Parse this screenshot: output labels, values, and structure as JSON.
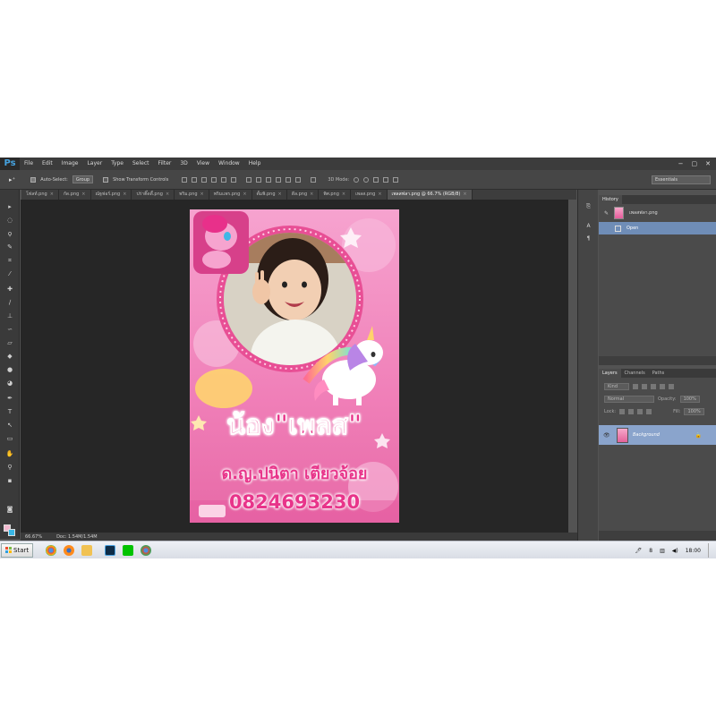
{
  "app": {
    "logo": "Ps"
  },
  "menu": [
    "File",
    "Edit",
    "Image",
    "Layer",
    "Type",
    "Select",
    "Filter",
    "3D",
    "View",
    "Window",
    "Help"
  ],
  "window_controls": [
    "−",
    "▢",
    "✕"
  ],
  "options": {
    "auto_select_label": "Auto-Select:",
    "group_value": "Group",
    "transform_label": "Show Transform Controls",
    "mode_3d": "3D Mode:",
    "workspace": "Essentials"
  },
  "tabs": [
    "โฟลท์.png",
    "กัด.png",
    "ณัฐฟอร์.png",
    "ปร่าติ๊ดดี้.png",
    "พริม.png",
    "พริมแพร.png",
    "ตั้มพิ.png",
    "ดีล.png",
    "พิศ.png",
    "เพลส.png",
    "เพลสฟลา.png @ 66.7% (RGB/8)"
  ],
  "poster": {
    "nickname": "น้อง\"เพลส\"",
    "fullname": "ด.ญ.ปนิตา เตียวจ้อย",
    "phone": "0824693230"
  },
  "statusbar": {
    "zoom": "66.67%",
    "doc": "Doc: 1.54M/1.54M"
  },
  "history": {
    "tabs": [
      "History"
    ],
    "snapshot": "เพลสฟลา.png",
    "step": "Open"
  },
  "layers": {
    "tabs": [
      "Layers",
      "Channels",
      "Paths"
    ],
    "kind": "Kind",
    "blend": "Normal",
    "opacity_label": "Opacity:",
    "opacity": "100%",
    "lock_label": "Lock:",
    "fill_label": "Fill:",
    "fill": "100%",
    "layer_name": "Background"
  },
  "taskbar": {
    "start": "Start",
    "clock": "18:00",
    "tray_num": "8"
  },
  "colors": {
    "foreground": "#f3b9cf",
    "background": "#39b6e5"
  }
}
